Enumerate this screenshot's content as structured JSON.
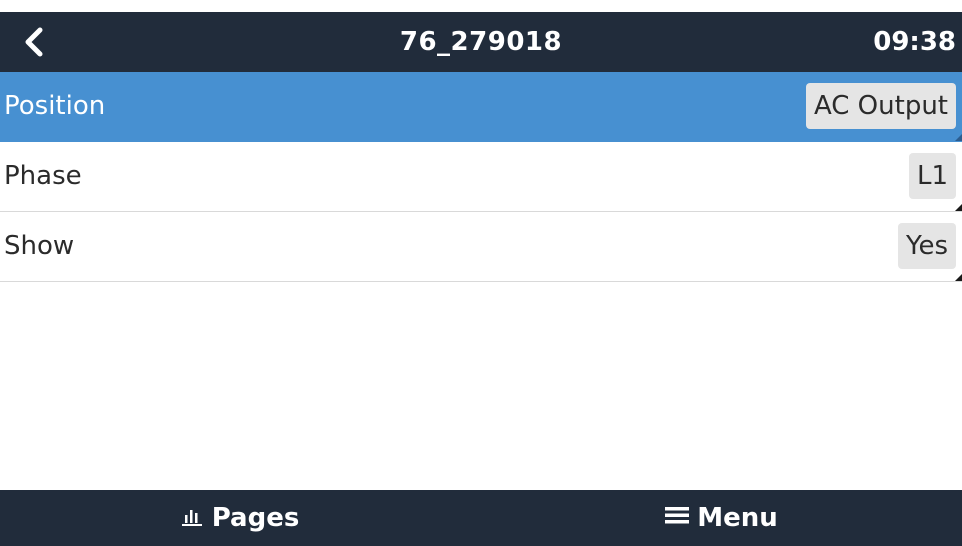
{
  "header": {
    "title": "76_279018",
    "time": "09:38",
    "back_icon": "chevron-left-icon"
  },
  "rows": [
    {
      "label": "Position",
      "value": "AC Output",
      "selected": true
    },
    {
      "label": "Phase",
      "value": "L1",
      "selected": false
    },
    {
      "label": "Show",
      "value": "Yes",
      "selected": false
    }
  ],
  "footer": {
    "pages_label": "Pages",
    "pages_icon": "bar-chart-icon",
    "menu_label": "Menu",
    "menu_icon": "hamburger-menu-icon"
  },
  "colors": {
    "header_bg": "#212c3b",
    "selected_row": "#4790d1",
    "value_box": "#e5e5e5",
    "divider": "#d9d9d9"
  }
}
